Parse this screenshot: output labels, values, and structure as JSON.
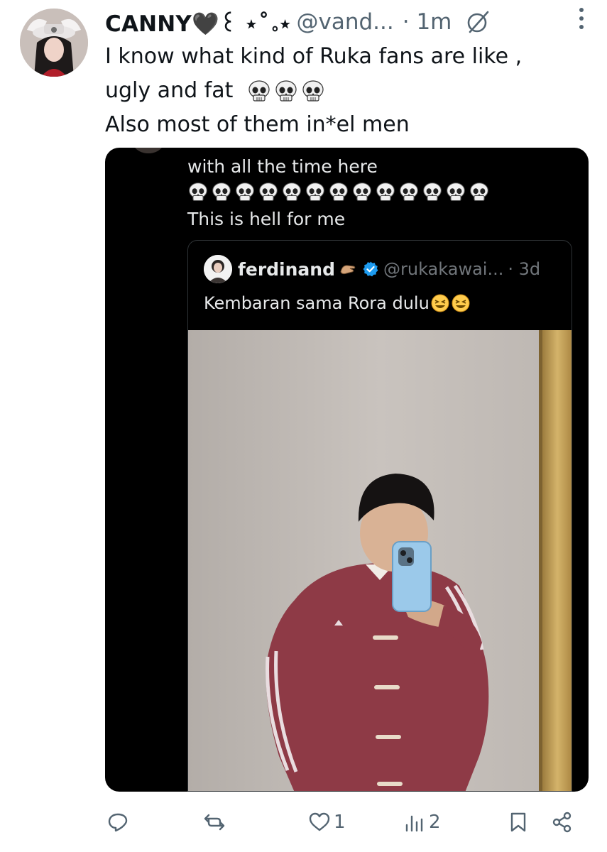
{
  "tweet": {
    "display_name": "CANNY🖤꒰ ⋆˚｡⋆",
    "handle": "@vand...",
    "time": "· 1m",
    "lines": [
      "I know what kind of Ruka fans are like ,",
      "ugly and fat",
      "Also most of them in*el men"
    ]
  },
  "screenshot": {
    "top_text": "with all the time here",
    "bottom_text": "This is hell for me",
    "quote": {
      "name": "ferdinand",
      "handle": "@rukakawai...",
      "time": "· 3d",
      "text": "Kembaran sama Rora dulu"
    }
  },
  "actions": {
    "reply_count": "",
    "retweet_count": "",
    "like_count": "1",
    "views_count": "2"
  },
  "colors": {
    "text_primary": "#0f1419",
    "text_secondary": "#536471",
    "verified_blue": "#1d9bf0",
    "jacket": "#8e3a46"
  },
  "icons": [
    "grok-icon",
    "more-icon",
    "skull-emoji",
    "verified-badge-icon",
    "laughing-emoji",
    "reply-icon",
    "retweet-icon",
    "like-icon",
    "views-icon",
    "bookmark-icon",
    "share-icon"
  ]
}
